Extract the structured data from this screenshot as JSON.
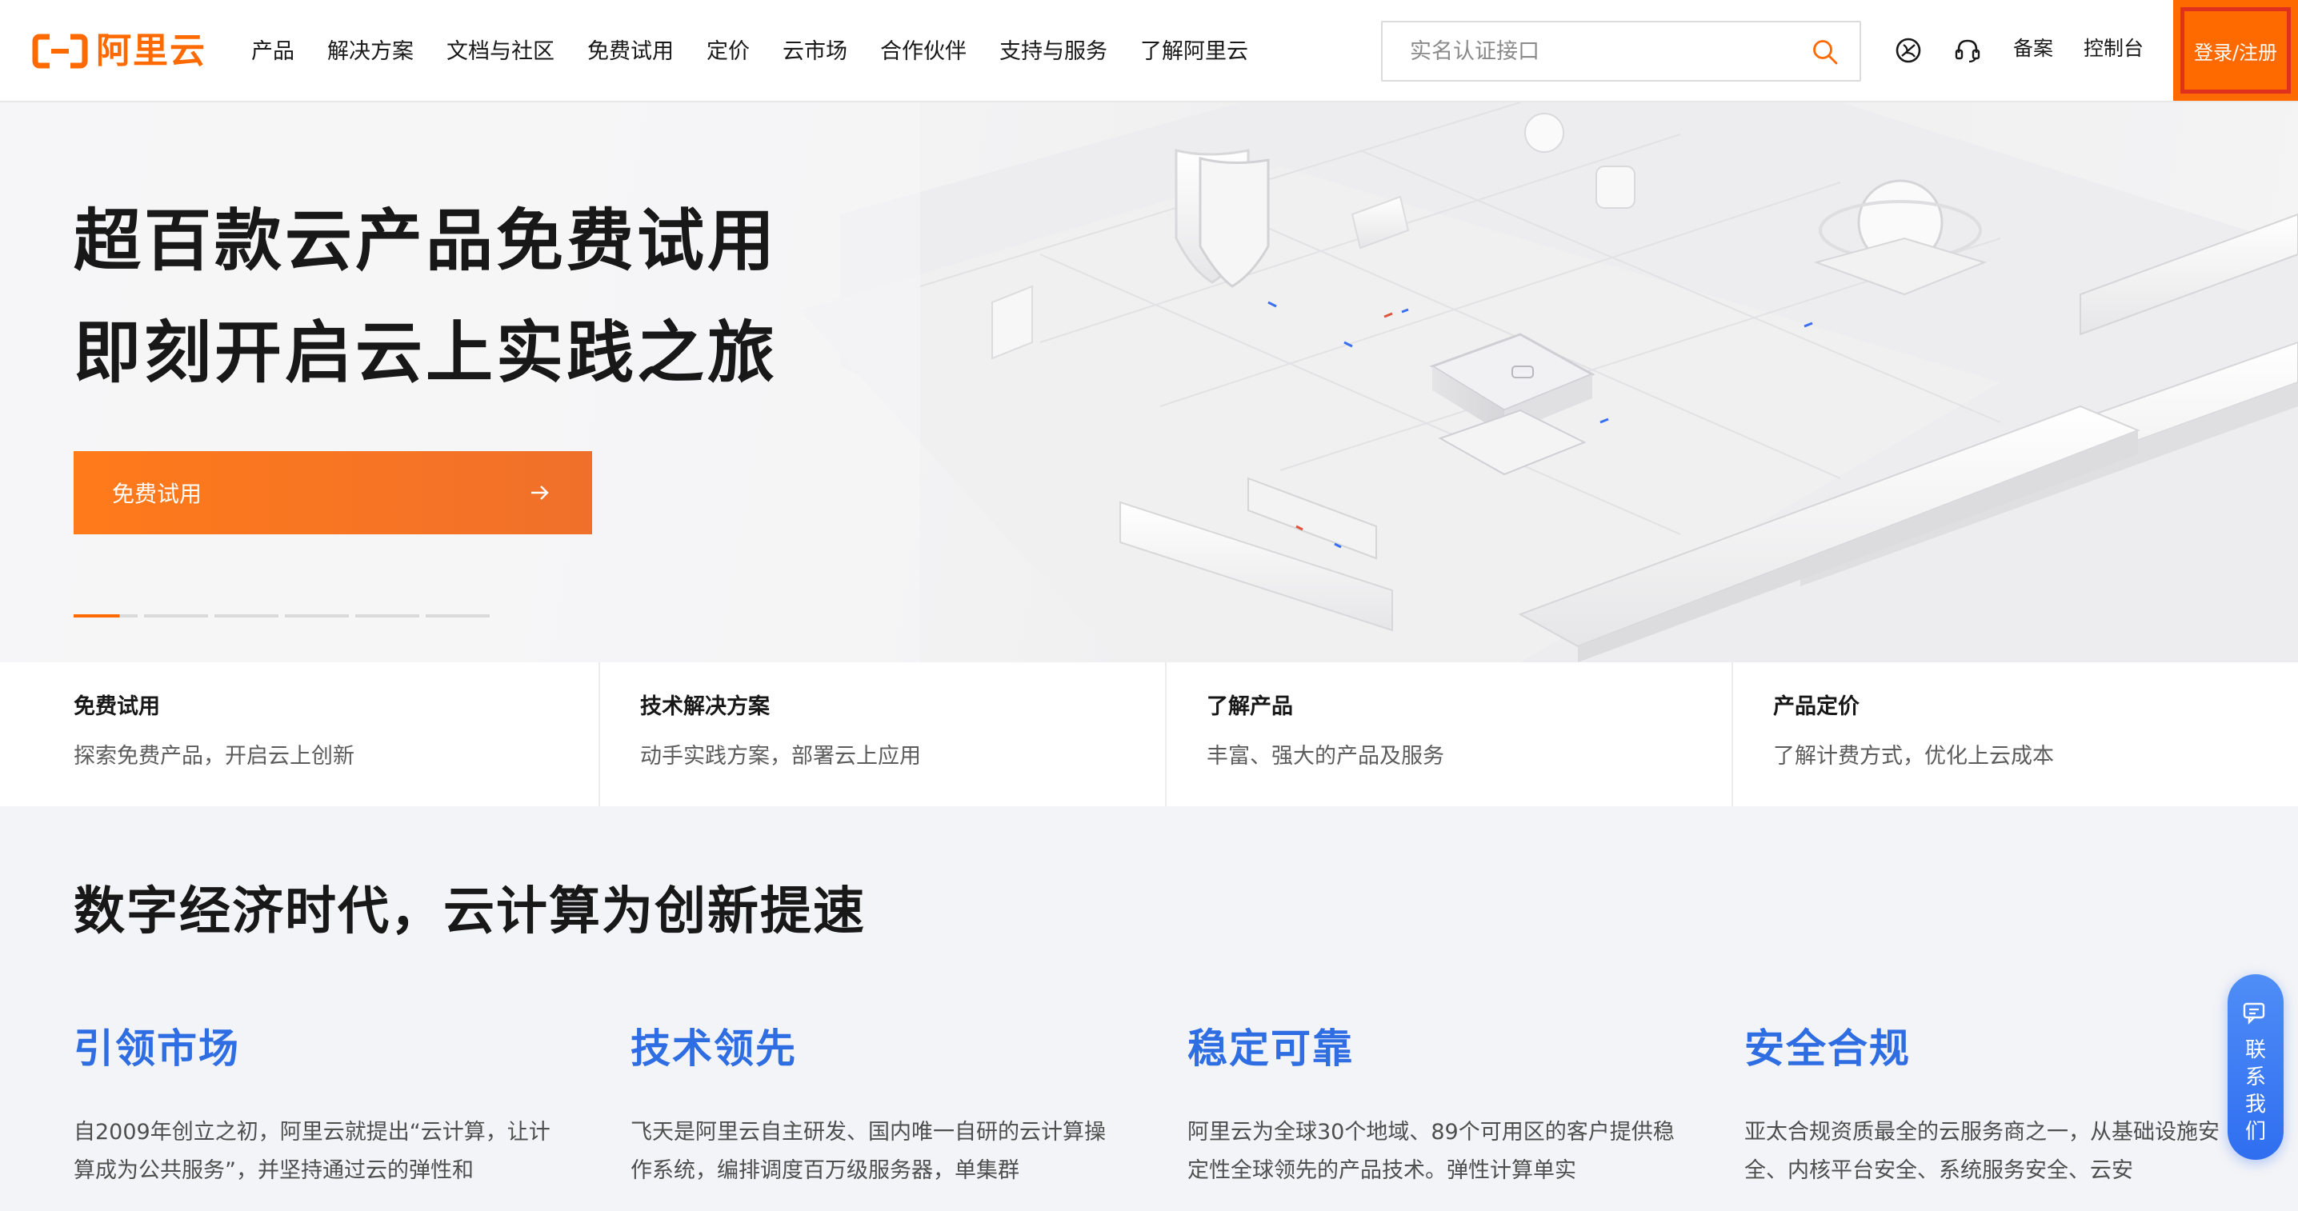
{
  "brand": {
    "logo_text": "阿里云",
    "accent": "#ff6a00",
    "link_blue": "#2f6ee2"
  },
  "nav": {
    "items": [
      "产品",
      "解决方案",
      "文档与社区",
      "免费试用",
      "定价",
      "云市场",
      "合作伙伴",
      "支持与服务",
      "了解阿里云"
    ]
  },
  "search": {
    "placeholder": "实名认证接口",
    "icon": "search-icon"
  },
  "toolbar": {
    "icons": [
      "globe-icon",
      "headset-icon"
    ],
    "beian_label": "备案",
    "console_label": "控制台",
    "login_label": "登录/注册"
  },
  "hero": {
    "title_line1": "超百款云产品免费试用",
    "title_line2": "即刻开启云上实践之旅",
    "cta_label": "免费试用",
    "cta_icon": "arrow-right-icon",
    "slide_count": 6,
    "active_slide": 1
  },
  "cards": [
    {
      "title": "免费试用",
      "desc": "探索免费产品，开启云上创新"
    },
    {
      "title": "技术解决方案",
      "desc": "动手实践方案，部署云上应用"
    },
    {
      "title": "了解产品",
      "desc": "丰富、强大的产品及服务"
    },
    {
      "title": "产品定价",
      "desc": "了解计费方式，优化上云成本"
    }
  ],
  "intro": {
    "heading": "数字经济时代，云计算为创新提速",
    "features": [
      {
        "title": "引领市场",
        "desc": "自2009年创立之初，阿里云就提出“云计算，让计算成为公共服务”，并坚持通过云的弹性和"
      },
      {
        "title": "技术领先",
        "desc": "飞天是阿里云自主研发、国内唯一自研的云计算操作系统，编排调度百万级服务器，单集群"
      },
      {
        "title": "稳定可靠",
        "desc": "阿里云为全球30个地域、89个可用区的客户提供稳定性全球领先的产品技术。弹性计算单实"
      },
      {
        "title": "安全合规",
        "desc": "亚太合规资质最全的云服务商之一，从基础设施安全、内核平台安全、系统服务安全、云安"
      }
    ]
  },
  "contact": {
    "label": "联系我们",
    "icon": "chat-icon"
  }
}
